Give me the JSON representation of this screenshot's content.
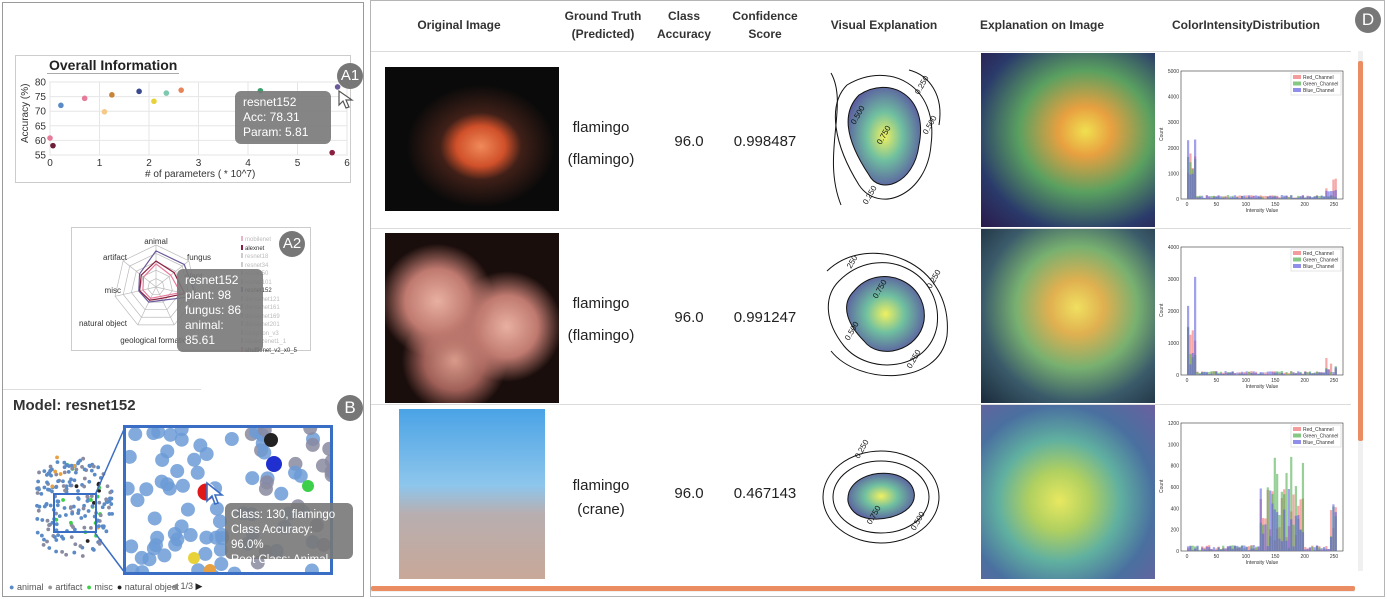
{
  "overall": {
    "title": "Overall Information",
    "badge": "A1",
    "ylabel": "Accuracy (%)",
    "xlabel": "# of parameters ( * 10^7)",
    "yticks": [
      "80",
      "75",
      "70",
      "65",
      "60",
      "55"
    ],
    "xticks": [
      "0",
      "1",
      "2",
      "3",
      "4",
      "5",
      "6"
    ],
    "tooltip": {
      "model": "resnet152",
      "acc": "Acc: 78.31",
      "param": "Param: 5.81"
    }
  },
  "scatter_points": [
    {
      "x": 0.0,
      "y": 60.8,
      "color": "#e87a9a"
    },
    {
      "x": 0.06,
      "y": 58.2,
      "color": "#6e1e3a"
    },
    {
      "x": 0.22,
      "y": 72.0,
      "color": "#5b8bc7"
    },
    {
      "x": 0.7,
      "y": 74.4,
      "color": "#e87a9a"
    },
    {
      "x": 1.1,
      "y": 69.8,
      "color": "#f5c98a"
    },
    {
      "x": 1.25,
      "y": 75.6,
      "color": "#c8843a"
    },
    {
      "x": 1.8,
      "y": 76.8,
      "color": "#3b4a8f"
    },
    {
      "x": 2.1,
      "y": 73.4,
      "color": "#e8d23a"
    },
    {
      "x": 2.35,
      "y": 76.2,
      "color": "#7ec8b0"
    },
    {
      "x": 2.65,
      "y": 77.2,
      "color": "#e8845a"
    },
    {
      "x": 4.25,
      "y": 77.0,
      "color": "#3a9f6a"
    },
    {
      "x": 5.7,
      "y": 55.8,
      "color": "#8a2040"
    },
    {
      "x": 5.81,
      "y": 78.31,
      "color": "#6a5a9a"
    }
  ],
  "radar": {
    "badge": "A2",
    "axes": [
      "animal",
      "fungus",
      "plant",
      "geological formation",
      "natural object",
      "misc",
      "artifact"
    ],
    "tooltip": {
      "model": "resnet152",
      "plant": "plant: 98",
      "fungus": "fungus: 86",
      "animal": "animal: 85.61"
    },
    "legend": [
      {
        "name": "mobilenet",
        "color": "#e8b4c8",
        "active": false
      },
      {
        "name": "alexnet",
        "color": "#8a2040",
        "active": true
      },
      {
        "name": "resnet18",
        "color": "#cccccc",
        "active": false
      },
      {
        "name": "resnet34",
        "color": "#cccccc",
        "active": false
      },
      {
        "name": "resnet50",
        "color": "#cccccc",
        "active": false
      },
      {
        "name": "resnet101",
        "color": "#cccccc",
        "active": false
      },
      {
        "name": "resnet152",
        "color": "#6a5a9a",
        "active": true
      },
      {
        "name": "densenet121",
        "color": "#cccccc",
        "active": false
      },
      {
        "name": "densenet161",
        "color": "#cccccc",
        "active": false
      },
      {
        "name": "densenet169",
        "color": "#cccccc",
        "active": false
      },
      {
        "name": "densenet201",
        "color": "#cccccc",
        "active": false
      },
      {
        "name": "inception_v3",
        "color": "#cccccc",
        "active": false
      },
      {
        "name": "squeezenet1_1",
        "color": "#cccccc",
        "active": false
      },
      {
        "name": "shufflenet_v2_x0_5",
        "color": "#e87a9a",
        "active": true
      }
    ]
  },
  "model_view": {
    "title": "Model: resnet152",
    "badge": "B",
    "tooltip": {
      "cls": "Class: 130, flamingo",
      "acc": "Class Accuracy: 96.0%",
      "root": "Root Class: Animal"
    },
    "legend": [
      {
        "label": "animal",
        "color": "#5b8bc7"
      },
      {
        "label": "artifact",
        "color": "#999999"
      },
      {
        "label": "misc",
        "color": "#3ecf4a"
      },
      {
        "label": "natural object",
        "color": "#222222"
      }
    ],
    "pager": "1/3"
  },
  "table": {
    "badge": "D",
    "headers": [
      "Original Image",
      "Ground Truth\n(Predicted)",
      "Class\nAccuracy",
      "Confidence\nScore",
      "Visual Explanation",
      "Explanation on Image",
      "ColorIntensityDistribution"
    ],
    "rows": [
      {
        "gt": "flamingo",
        "pred": "(flamingo)",
        "acc": "96.0",
        "conf": "0.998487",
        "contours": [
          "0.250",
          "0.500",
          "0.750",
          "0.500",
          "0.250"
        ],
        "hist_ymax": "5000",
        "hist_yticks": [
          "5000",
          "4000",
          "3000",
          "2000",
          "1000",
          "0"
        ]
      },
      {
        "gt": "flamingo",
        "pred": "(flamingo)",
        "acc": "96.0",
        "conf": "0.991247",
        "contours": [
          "250",
          "0.250",
          "0.750",
          "0.500",
          "0.250"
        ],
        "hist_ymax": "4000",
        "hist_yticks": [
          "4000",
          "3000",
          "2000",
          "1000",
          "0"
        ]
      },
      {
        "gt": "flamingo",
        "pred": "(crane)",
        "acc": "96.0",
        "conf": "0.467143",
        "contours": [
          "0.250",
          "0.750",
          "0.500"
        ],
        "hist_ymax": "1200",
        "hist_yticks": [
          "1200",
          "1000",
          "800",
          "600",
          "400",
          "200",
          "0"
        ]
      }
    ],
    "hist_legend": [
      "Red_Channel",
      "Green_Channel",
      "Blue_Channel"
    ],
    "hist_xticks": [
      "0",
      "50",
      "100",
      "150",
      "200",
      "250"
    ],
    "hist_xlabel": "Intensity Value",
    "hist_ylabel": "Count"
  }
}
